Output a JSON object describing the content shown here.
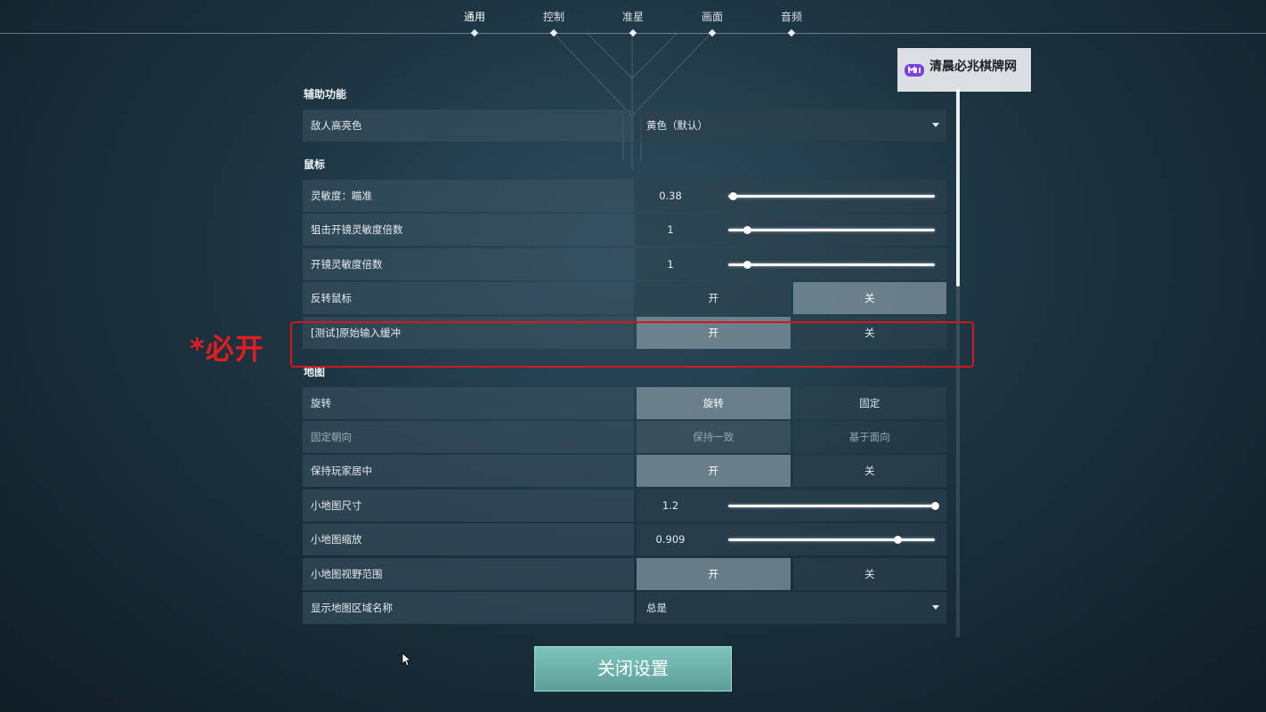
{
  "nav": {
    "tabs": [
      {
        "label": "通用",
        "active": true
      },
      {
        "label": "控制",
        "active": false
      },
      {
        "label": "准星",
        "active": false
      },
      {
        "label": "画面",
        "active": false
      },
      {
        "label": "音频",
        "active": false
      }
    ]
  },
  "watermark": {
    "text": "清晨必兆棋牌网"
  },
  "annotation": {
    "text": "*必开",
    "color": "#e31c22"
  },
  "settings": {
    "accessibility": {
      "title": "辅助功能",
      "enemy_highlight": {
        "label": "敌人高亮色",
        "value": "黄色（默认）"
      }
    },
    "mouse": {
      "title": "鼠标",
      "sensitivity_aim": {
        "label": "灵敏度：瞄准",
        "value": "0.38",
        "fraction": 0.02
      },
      "sniper_zoom_mult": {
        "label": "狙击开镜灵敏度倍数",
        "value": "1",
        "fraction": 0.09
      },
      "zoom_mult": {
        "label": "开镜灵敏度倍数",
        "value": "1",
        "fraction": 0.09
      },
      "invert_mouse": {
        "label": "反转鼠标",
        "on": "开",
        "off": "关",
        "selected": "off"
      },
      "raw_input_buffer": {
        "label": "[测试]原始输入缓冲",
        "on": "开",
        "off": "关",
        "selected": "on"
      }
    },
    "map": {
      "title": "地图",
      "rotate": {
        "label": "旋转",
        "on": "旋转",
        "off": "固定",
        "selected": "on"
      },
      "fixed_orientation": {
        "label": "固定朝向",
        "on": "保持一致",
        "off": "基于面向",
        "selected": "on"
      },
      "keep_player_centered": {
        "label": "保持玩家居中",
        "on": "开",
        "off": "关",
        "selected": "on"
      },
      "minimap_size": {
        "label": "小地图尺寸",
        "value": "1.2",
        "fraction": 1.0
      },
      "minimap_zoom": {
        "label": "小地图缩放",
        "value": "0.909",
        "fraction": 0.82
      },
      "minimap_vision_cones": {
        "label": "小地图视野范围",
        "on": "开",
        "off": "关",
        "selected": "on"
      },
      "show_region_names": {
        "label": "显示地图区域名称",
        "value": "总是"
      }
    }
  },
  "close_button": {
    "label": "关闭设置"
  },
  "colors": {
    "accent": "#7ec4bd",
    "highlight_box": "#d4171c"
  }
}
